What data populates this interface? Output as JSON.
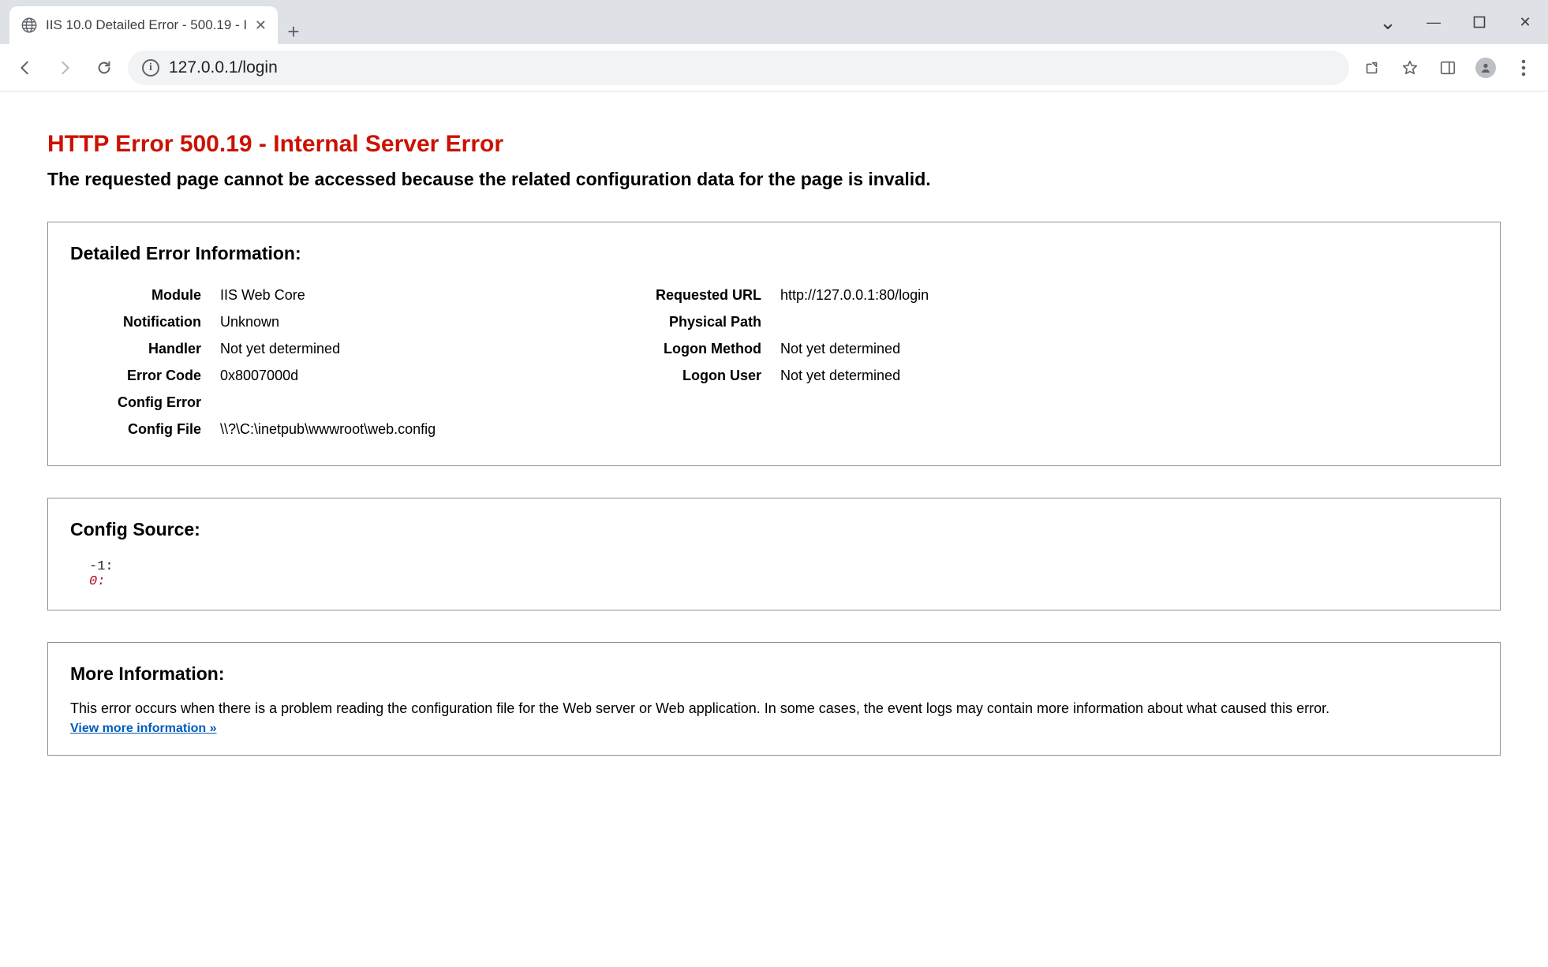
{
  "browser": {
    "tab_title": "IIS 10.0 Detailed Error - 500.19 - I",
    "url": "127.0.0.1/login",
    "placeholder": "",
    "window": {
      "min": "—",
      "max": "▢",
      "close": "✕",
      "caret": "⌄"
    }
  },
  "page": {
    "title": "HTTP Error 500.19 - Internal Server Error",
    "subtitle": "The requested page cannot be accessed because the related configuration data for the page is invalid.",
    "detail_heading": "Detailed Error Information:",
    "kv_left": [
      {
        "k": "Module",
        "v": "IIS Web Core"
      },
      {
        "k": "Notification",
        "v": "Unknown"
      },
      {
        "k": "Handler",
        "v": "Not yet determined"
      },
      {
        "k": "Error Code",
        "v": "0x8007000d"
      },
      {
        "k": "Config Error",
        "v": ""
      },
      {
        "k": "Config File",
        "v": "\\\\?\\C:\\inetpub\\wwwroot\\web.config"
      }
    ],
    "kv_right": [
      {
        "k": "Requested URL",
        "v": "http://127.0.0.1:80/login"
      },
      {
        "k": "Physical Path",
        "v": ""
      },
      {
        "k": "Logon Method",
        "v": "Not yet determined"
      },
      {
        "k": "Logon User",
        "v": "Not yet determined"
      }
    ],
    "config_source_heading": "Config Source:",
    "config_source_lines": {
      "l1": "-1:",
      "l2": "0:"
    },
    "more_heading": "More Information:",
    "more_text": "This error occurs when there is a problem reading the configuration file for the Web server or Web application. In some cases, the event logs may contain more information about what caused this error.",
    "more_link": "View more information »"
  }
}
